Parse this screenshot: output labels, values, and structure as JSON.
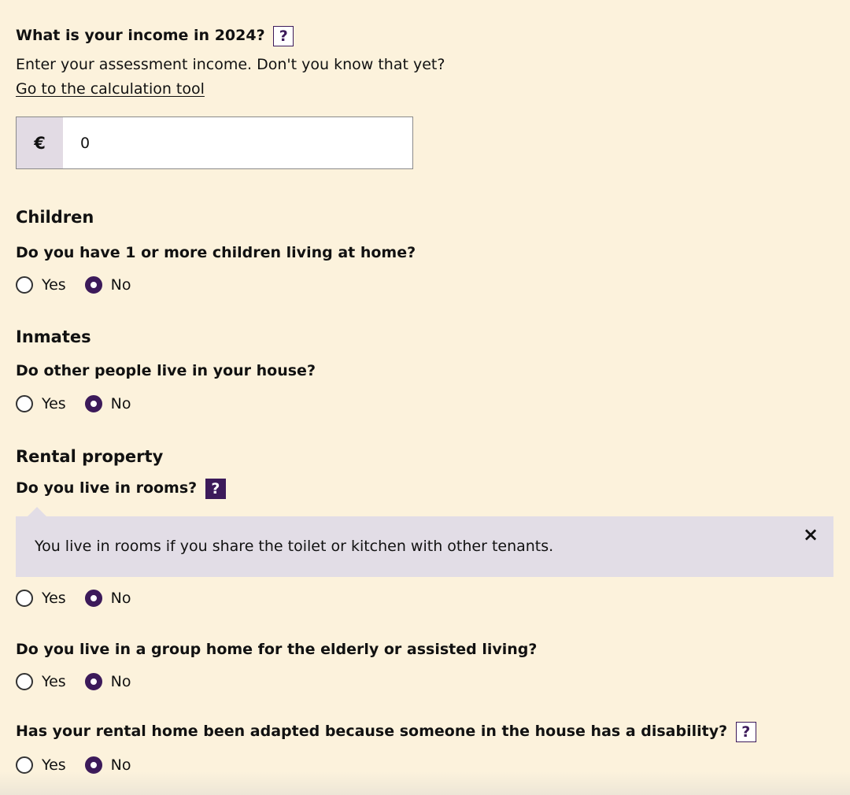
{
  "income": {
    "question": "What is your income in 2024?",
    "help_symbol": "?",
    "description": "Enter your assessment income. Don't you know that yet?",
    "link_label": "Go to the calculation tool",
    "currency_symbol": "€",
    "value": "0"
  },
  "children": {
    "heading": "Children",
    "question": "Do you have 1 or more children living at home?",
    "options": [
      "Yes",
      "No"
    ],
    "selected": "No"
  },
  "inmates": {
    "heading": "Inmates",
    "question": "Do other people live in your house?",
    "options": [
      "Yes",
      "No"
    ],
    "selected": "No"
  },
  "rental": {
    "heading": "Rental property",
    "rooms": {
      "question": "Do you live in rooms?",
      "help_symbol": "?",
      "help_open": true,
      "tooltip": "You live in rooms if you share the toilet or kitchen with other tenants.",
      "close_symbol": "×",
      "options": [
        "Yes",
        "No"
      ],
      "selected": "No"
    },
    "group_home": {
      "question": "Do you live in a group home for the elderly or assisted living?",
      "options": [
        "Yes",
        "No"
      ],
      "selected": "No"
    },
    "adapted": {
      "question": "Has your rental home been adapted because someone in the house has a disability?",
      "help_symbol": "?",
      "options": [
        "Yes",
        "No"
      ],
      "selected": "No"
    }
  },
  "colors": {
    "background": "#fcf2dc",
    "accent": "#3c1a5a",
    "tooltip_bg": "#e2dde6",
    "prefix_bg": "#e2dbe4"
  }
}
